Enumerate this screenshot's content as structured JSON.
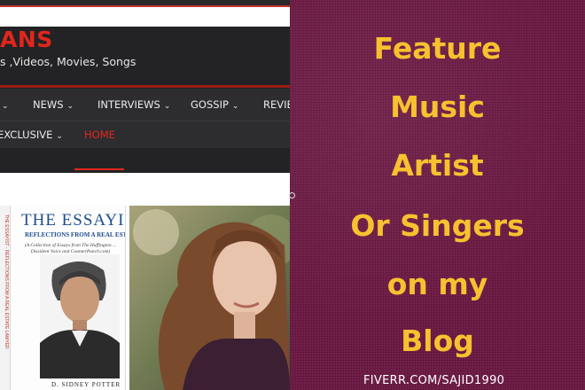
{
  "blog": {
    "site_title_partial": "ANS",
    "tagline_partial": "s ,Videos, Movies, Songs",
    "nav_primary": [
      {
        "label": "",
        "has_dropdown": true
      },
      {
        "label": "NEWS",
        "has_dropdown": true
      },
      {
        "label": "INTERVIEWS",
        "has_dropdown": true
      },
      {
        "label": "GOSSIP",
        "has_dropdown": true
      },
      {
        "label": "REVIE",
        "has_dropdown": false
      }
    ],
    "nav_secondary": [
      {
        "label": "EXCLUSIVE",
        "has_dropdown": true
      },
      {
        "label": "HOME",
        "active": true
      }
    ],
    "book": {
      "title": "THE ESSAYI",
      "subtitle": "REFLECTIONS FROM A REAL ESTATE",
      "description": "(A Collection of Essays from The Huffington ... Dissident Voice and CounterPunch.com)",
      "spine_text": "THE ESSAYIST · REFLECTIONS FROM A REAL ESTATE LAWYER",
      "author": "D. SIDNEY POTTER"
    }
  },
  "ad": {
    "lines": [
      "Feature",
      "Music",
      "Artist",
      "Or Singers",
      "on my",
      "Blog"
    ],
    "footer": "FIVERR.COM/SAJID1990"
  },
  "colors": {
    "accent_red": "#e3261c",
    "nav_bg": "#2d2d2f",
    "ad_bg": "#6b1741",
    "ad_text": "#f7c12f"
  },
  "icons": {
    "dropdown": "chevron-down-icon"
  }
}
